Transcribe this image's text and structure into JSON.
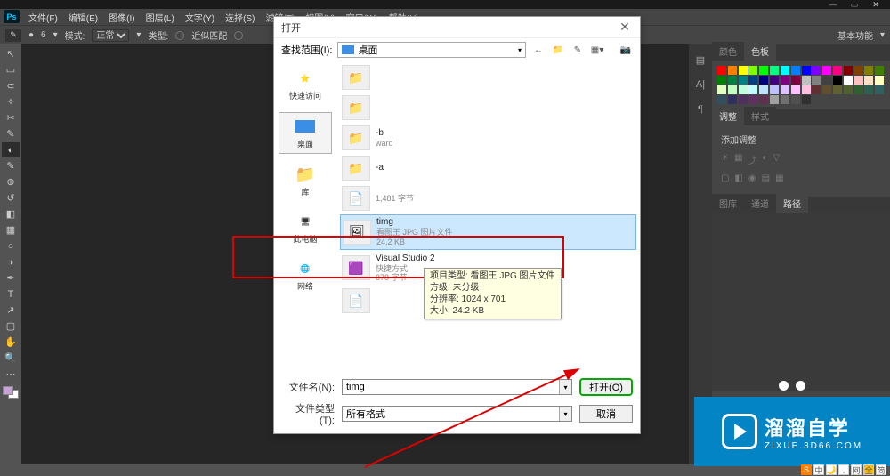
{
  "menubar": {
    "items": [
      "文件(F)",
      "编辑(E)",
      "图像(I)",
      "图层(L)",
      "文字(Y)",
      "选择(S)",
      "滤镜(T)",
      "视图(V)",
      "窗口(W)",
      "帮助(H)"
    ]
  },
  "optbar": {
    "brush_size": "6",
    "mode_label": "模式:",
    "mode_value": "正常",
    "type_label": "类型:",
    "opt1": "近似匹配",
    "opt2": "",
    "right_label": "基本功能"
  },
  "right_panels": {
    "color_tab": "颜色",
    "swatch_tab": "色板",
    "adjust_tab": "调整",
    "style_tab": "样式",
    "add_adjust": "添加调整",
    "library_tab": "图库",
    "channel_tab": "通道",
    "path_tab": "路径"
  },
  "dialog": {
    "title": "打开",
    "lookin_label": "查找范围(I):",
    "lookin_value": "桌面",
    "places": {
      "quick": "快速访问",
      "desktop": "桌面",
      "library": "库",
      "thispc": "此电脑",
      "network": "网络"
    },
    "files": [
      {
        "name": "",
        "type": "",
        "size": ""
      },
      {
        "name": "",
        "type": "",
        "size": ""
      },
      {
        "name": "-b",
        "type": "ward",
        "size": ""
      },
      {
        "name": "-a",
        "type": "",
        "size": ""
      },
      {
        "name": "",
        "type": "1,481 字节",
        "size": ""
      },
      {
        "name": "timg",
        "type": "看图王 JPG 图片文件",
        "size": "24.2 KB"
      },
      {
        "name": "Visual Studio 2",
        "type": "快捷方式",
        "size": "878 字节"
      },
      {
        "name": "",
        "type": "",
        "size": ""
      }
    ],
    "tooltip": {
      "l1": "项目类型: 看图王 JPG 图片文件",
      "l2": "方级: 未分级",
      "l3": "分辨率: 1024 x 701",
      "l4": "大小: 24.2 KB"
    },
    "filename_label": "文件名(N):",
    "filename_value": "timg",
    "filetype_label": "文件类型(T):",
    "filetype_value": "所有格式",
    "open_btn": "打开(O)",
    "cancel_btn": "取消"
  },
  "brand": {
    "cn": "溜溜自学",
    "en": "ZIXUE.3D66.COM"
  },
  "tray": {
    "items": [
      "S",
      "中",
      "🌙",
      ",",
      "网",
      "全",
      "简"
    ]
  },
  "swatch_colors": [
    "#ff0000",
    "#ff8000",
    "#ffff00",
    "#80ff00",
    "#00ff00",
    "#00ff80",
    "#00ffff",
    "#0080ff",
    "#0000ff",
    "#8000ff",
    "#ff00ff",
    "#ff0080",
    "#800000",
    "#804000",
    "#808000",
    "#408000",
    "#008000",
    "#008040",
    "#008080",
    "#004080",
    "#000080",
    "#400080",
    "#800080",
    "#800040",
    "#c0c0c0",
    "#808080",
    "#404040",
    "#000000",
    "#ffffff",
    "#ffc0c0",
    "#ffe0c0",
    "#ffffc0",
    "#e0ffc0",
    "#c0ffc0",
    "#c0ffe0",
    "#c0ffff",
    "#c0e0ff",
    "#c0c0ff",
    "#e0c0ff",
    "#ffc0ff",
    "#ffc0e0",
    "#603030",
    "#605030",
    "#606030",
    "#506030",
    "#306030",
    "#306050",
    "#306060",
    "#305060",
    "#303060",
    "#503060",
    "#603060",
    "#603050",
    "#a0a0a0",
    "#707070",
    "#505050",
    "#303030"
  ]
}
